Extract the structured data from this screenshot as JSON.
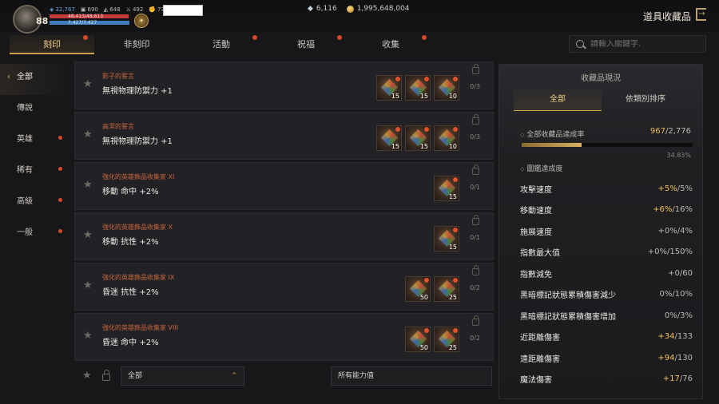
{
  "header": {
    "level": "88",
    "stats": [
      {
        "icon": "shield-icon",
        "value": "32,767",
        "blue": true
      },
      {
        "icon": "armor-icon",
        "value": "690",
        "blue": false
      },
      {
        "icon": "weight-icon",
        "value": "648",
        "blue": false
      },
      {
        "icon": "sword-icon",
        "value": "492",
        "blue": false
      },
      {
        "icon": "fist-icon",
        "value": "731",
        "blue": false
      }
    ],
    "hp_text": "48,413/48,613",
    "hp_fraction": 0.99,
    "mp_text": "7,427/7,427",
    "mp_fraction": 1.0,
    "diamonds": "6,116",
    "gold": "1,995,648,004",
    "page_title": "道具收藏品"
  },
  "tabs": [
    {
      "label": "刻印",
      "active": true,
      "dot": true
    },
    {
      "label": "非刻印",
      "active": false,
      "dot": false
    },
    {
      "label": "活動",
      "active": false,
      "dot": true
    },
    {
      "label": "祝福",
      "active": false,
      "dot": true
    },
    {
      "label": "收集",
      "active": false,
      "dot": true
    }
  ],
  "search": {
    "placeholder": "請輸入關鍵字."
  },
  "sidebar": [
    {
      "label": "全部",
      "active": true,
      "dot": false
    },
    {
      "label": "傳說",
      "active": false,
      "dot": false
    },
    {
      "label": "英雄",
      "active": false,
      "dot": true
    },
    {
      "label": "稀有",
      "active": false,
      "dot": true
    },
    {
      "label": "高級",
      "active": false,
      "dot": true
    },
    {
      "label": "一般",
      "active": false,
      "dot": true
    }
  ],
  "collections": [
    {
      "category": "影子的誓言",
      "name": "無視物理防禦力 +1",
      "items": [
        "15",
        "15",
        "10"
      ],
      "progress": "0/3"
    },
    {
      "category": "高潔的誓言",
      "name": "無視物理防禦力 +1",
      "items": [
        "15",
        "15",
        "10"
      ],
      "progress": "0/3"
    },
    {
      "category": "強化的英雄飾品收集家 XI",
      "name": "移動 命中 +2%",
      "items": [
        "15"
      ],
      "progress": "0/1"
    },
    {
      "category": "強化的英雄飾品收集家 X",
      "name": "移動 抗性 +2%",
      "items": [
        "15"
      ],
      "progress": "0/1"
    },
    {
      "category": "強化的英雄飾品收集家 IX",
      "name": "昏迷 抗性 +2%",
      "items": [
        "50",
        "25"
      ],
      "progress": "0/2"
    },
    {
      "category": "強化的英雄飾品收集家 VIII",
      "name": "昏迷 命中 +2%",
      "items": [
        "50",
        "25"
      ],
      "progress": "0/2"
    }
  ],
  "filters": {
    "left": "全部",
    "right": "所有能力值"
  },
  "panel": {
    "title": "收藏品現況",
    "tabs": [
      {
        "label": "全部",
        "active": true
      },
      {
        "label": "依類別排序",
        "active": false
      }
    ],
    "rate_label": "全部收藏品達成率",
    "rate_current": "967",
    "rate_total": "/2,776",
    "rate_pct": "34.83%",
    "rate_fraction": 0.3483,
    "codex_label": "圖鑑達成度",
    "stats": [
      {
        "name": "攻擊速度",
        "current": "+5%",
        "max": "/5%",
        "gold": true
      },
      {
        "name": "移動速度",
        "current": "+6%",
        "max": "/16%",
        "gold": true
      },
      {
        "name": "施展速度",
        "current": "+0%",
        "max": "/4%",
        "gold": false
      },
      {
        "name": "指數最大值",
        "current": "+0%",
        "max": "/150%",
        "gold": false
      },
      {
        "name": "指數減免",
        "current": "+0",
        "max": "/60",
        "gold": false
      },
      {
        "name": "黑暗標記狀態累積傷害減少",
        "current": "0%",
        "max": "/10%",
        "gold": false
      },
      {
        "name": "黑暗標記狀態累積傷害增加",
        "current": "0%",
        "max": "/3%",
        "gold": false
      },
      {
        "name": "近距離傷害",
        "current": "+34",
        "max": "/133",
        "gold": true
      },
      {
        "name": "遠距離傷害",
        "current": "+94",
        "max": "/130",
        "gold": true
      },
      {
        "name": "魔法傷害",
        "current": "+17",
        "max": "/76",
        "gold": true
      }
    ]
  }
}
